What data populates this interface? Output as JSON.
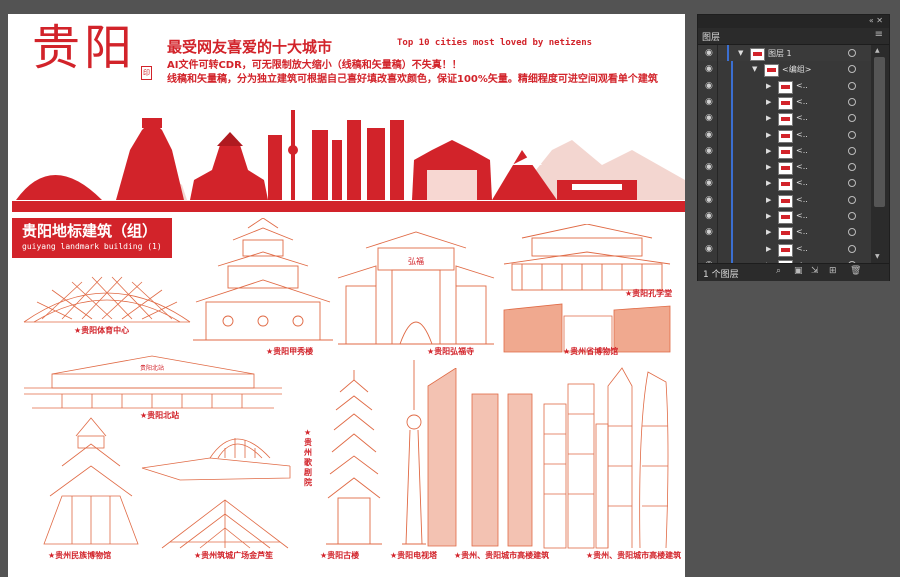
{
  "poster": {
    "title": "贵阳",
    "stamp": "印",
    "headline": "最受网友喜爱的十大城市",
    "headline_en": "Top 10 cities most loved by netizens",
    "desc1": "AI文件可转CDR，可无限制放大缩小（线稿和矢量稿）不失真！！",
    "desc2": "线稿和矢量稿，分为独立建筑可根据自己喜好填改喜欢颜色，保证100%矢量。精细程度可进空间观看单个建筑",
    "section_title": "贵阳地标建筑（组）",
    "section_en": "guiyang landmark building (1)",
    "captions": {
      "stadium": "★贵阳体育中心",
      "jiaxiu": "★贵阳甲秀楼",
      "hongfu": "★贵阳弘福寺",
      "confucius": "★贵阳孔学堂",
      "museum": "★贵州省博物馆",
      "north_station": "★贵阳北站",
      "opera": "★贵州歌剧院",
      "ethnic_museum": "★贵州民族博物馆",
      "plaza": "★贵州筑城广场金芦笙",
      "pagoda": "★贵阳古楼",
      "tv_tower": "★贵阳电视塔",
      "highrise1": "★贵州、贵阳城市高楼建筑",
      "highrise2": "★贵州、贵阳城市高楼建筑"
    },
    "gate_plaque": "弘福",
    "station_sign": "贵阳北站",
    "colors": {
      "accent": "#d2232a",
      "line": "#e06a45",
      "canvas": "#535353"
    }
  },
  "layers_panel": {
    "tab": "图层",
    "collapse_icon": "double-chevron-icon",
    "close_icon": "close-icon",
    "menu_icon": "hamburger-icon",
    "rows": [
      {
        "label": "图层 1",
        "kind": "layer"
      },
      {
        "label": "<编组>",
        "kind": "group"
      },
      {
        "label": "<..",
        "kind": "item"
      },
      {
        "label": "<..",
        "kind": "item"
      },
      {
        "label": "<..",
        "kind": "item"
      },
      {
        "label": "<..",
        "kind": "item"
      },
      {
        "label": "<..",
        "kind": "item"
      },
      {
        "label": "<..",
        "kind": "item"
      },
      {
        "label": "<..",
        "kind": "item"
      },
      {
        "label": "<..",
        "kind": "item"
      },
      {
        "label": "<..",
        "kind": "item"
      },
      {
        "label": "<..",
        "kind": "item"
      },
      {
        "label": "<..",
        "kind": "item"
      },
      {
        "label": "<..",
        "kind": "item"
      }
    ],
    "footer_count": "1 个图层",
    "footer_icons": [
      "search-icon",
      "make-clip-mask-icon",
      "sublayer-icon",
      "new-layer-icon",
      "delete-icon"
    ]
  }
}
